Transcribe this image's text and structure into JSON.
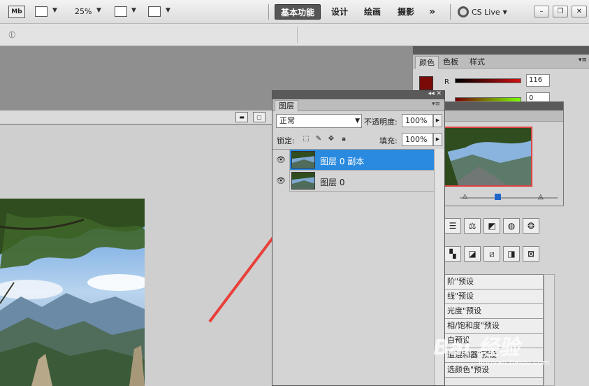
{
  "appbar": {
    "logo": "Mb",
    "zoom": "25%",
    "workspaces": [
      "基本功能",
      "设计",
      "绘画",
      "摄影"
    ],
    "more": "»",
    "cslive": "CS Live"
  },
  "color_panel": {
    "tabs": [
      "颜色",
      "色板",
      "样式"
    ],
    "r_label": "R",
    "r_value": "116",
    "g_value": "0",
    "swatch_color": "#7a0a08"
  },
  "layers_panel": {
    "tab": "图层",
    "blend_mode": "正常",
    "opacity_label": "不透明度:",
    "opacity_value": "100%",
    "lock_label": "锁定:",
    "fill_label": "填充:",
    "fill_value": "100%",
    "layers": [
      {
        "name": "图层 0 副本",
        "selected": true
      },
      {
        "name": "图层 0",
        "selected": false
      }
    ]
  },
  "adjustments": {
    "presets": [
      "阶\"预设",
      "线\"预设",
      "光度\"预设",
      "相/饱和度\"预设",
      "白预设",
      "道混和器\"预设",
      "选颜色\"预设"
    ]
  },
  "colors": {
    "selection": "#2a8adf",
    "arrow": "#e8403a"
  }
}
